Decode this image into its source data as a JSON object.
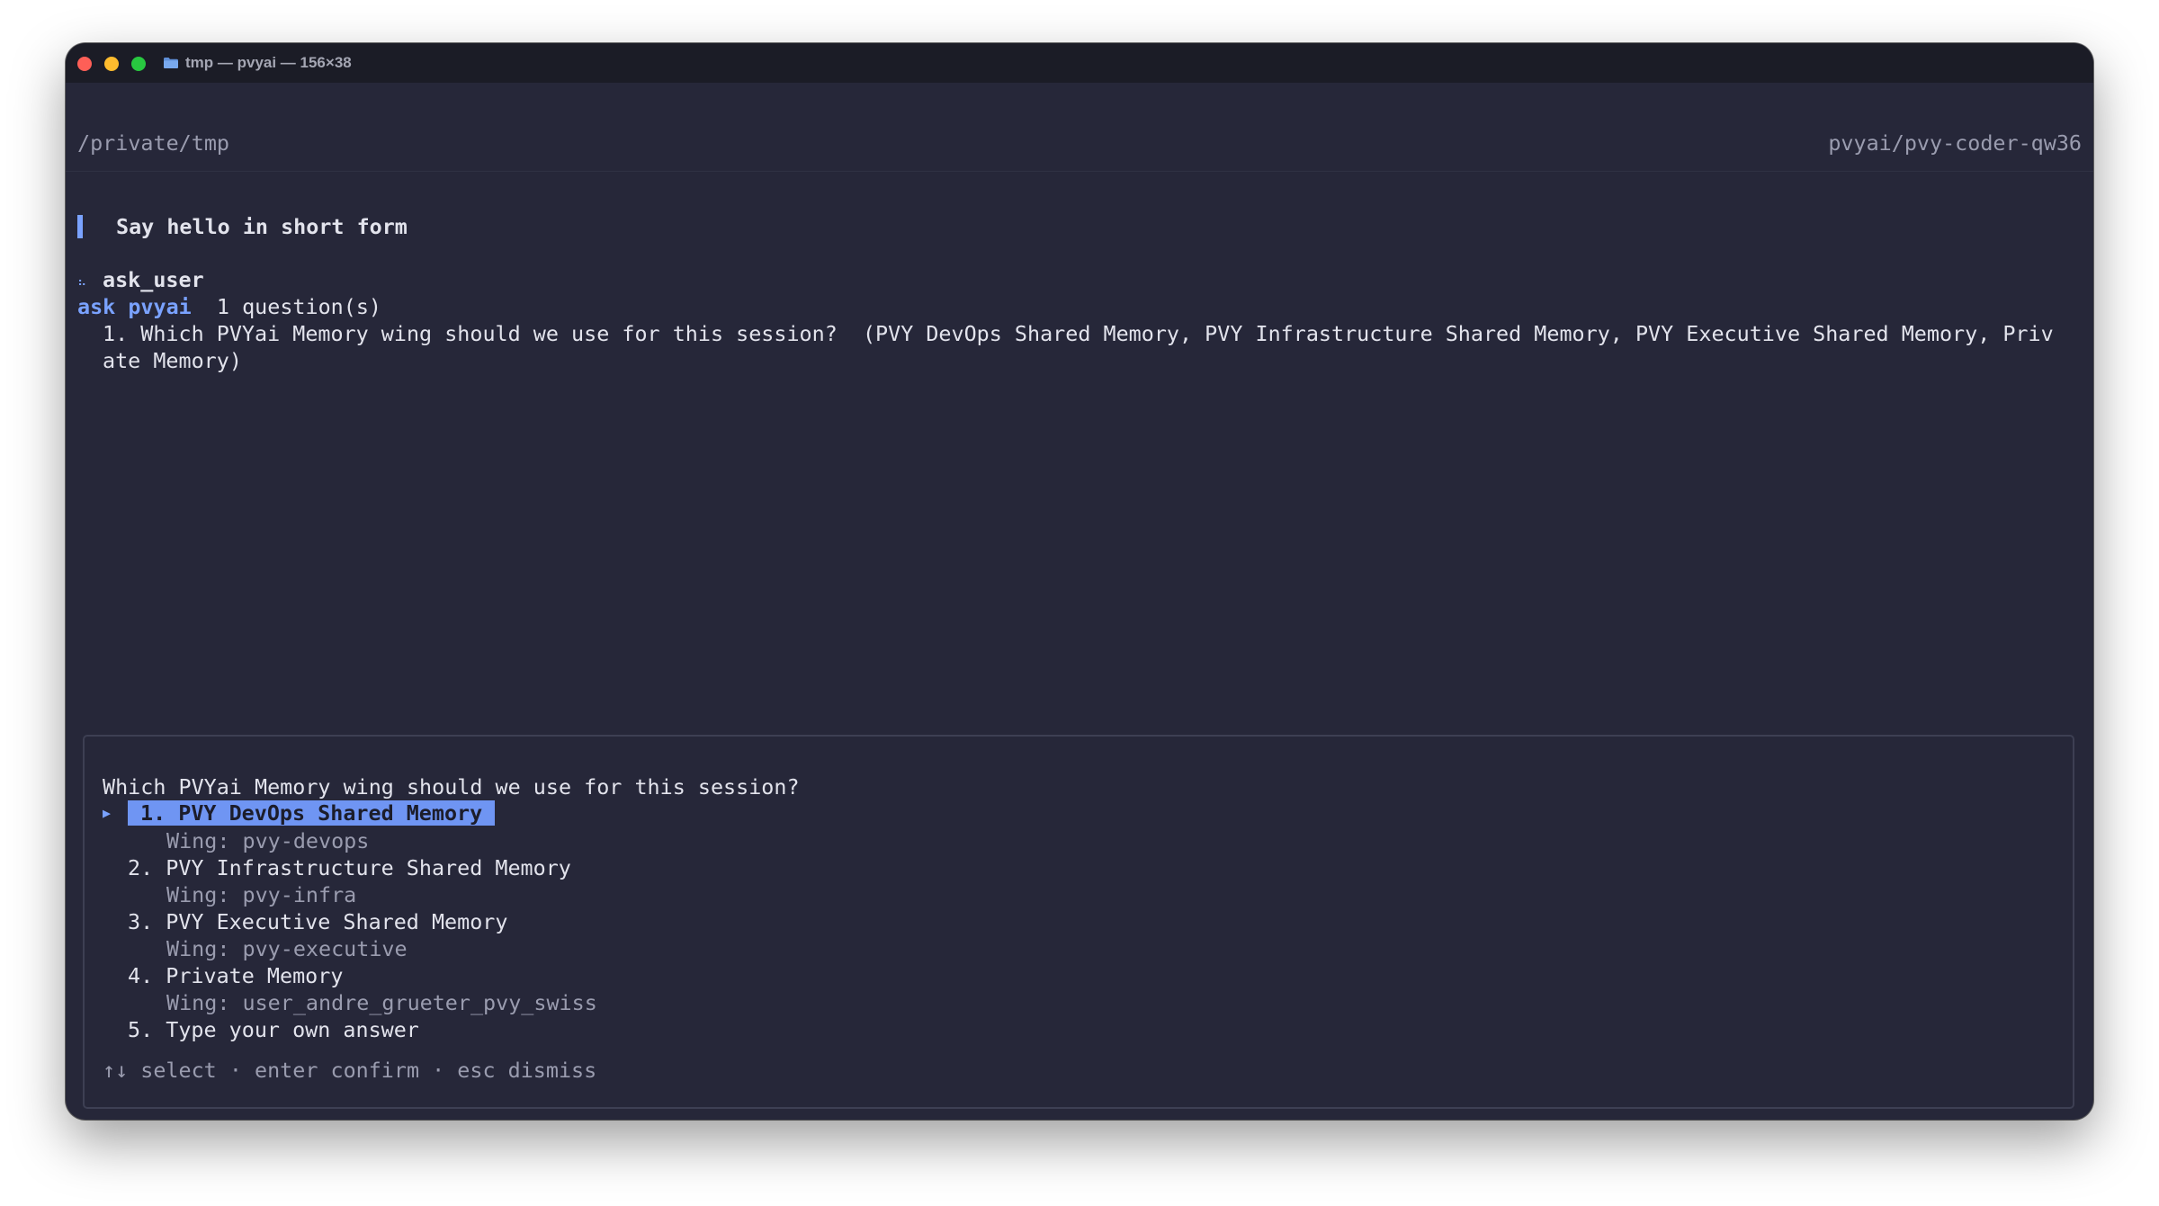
{
  "window": {
    "title": "tmp — pvyai — 156×38"
  },
  "header": {
    "path": "/private/tmp",
    "model": "pvyai/pvy-coder-qw36"
  },
  "conversation": {
    "user_prompt": "Say hello in short form",
    "tool_icon_glyph": "⠦",
    "tool_name": "ask_user",
    "ask_label": "ask pvyai",
    "ask_count": "1 question(s)",
    "question_line_1": "1. Which PVYai Memory wing should we use for this session?  (PVY DevOps Shared Memory, PVY Infrastructure Shared Memory, PVY Executive Shared Memory, Priv",
    "question_line_2": "ate Memory)"
  },
  "panel": {
    "question": "Which PVYai Memory wing should we use for this session?",
    "selected_marker": "▶",
    "options": [
      {
        "label": "1. PVY DevOps Shared Memory",
        "desc": "Wing: pvy-devops"
      },
      {
        "label": "2. PVY Infrastructure Shared Memory",
        "desc": "Wing: pvy-infra"
      },
      {
        "label": "3. PVY Executive Shared Memory",
        "desc": "Wing: pvy-executive"
      },
      {
        "label": "4. Private Memory",
        "desc": "Wing: user_andre_grueter_pvy_swiss"
      },
      {
        "label": "5. Type your own answer"
      }
    ],
    "footer": "↑↓ select · enter confirm · esc dismiss"
  },
  "status": {
    "mode": "ask"
  },
  "colors": {
    "background": "#262739",
    "accent": "#7aa2ff",
    "selection": "#6f95f3",
    "status_text": "#f5d77a"
  }
}
